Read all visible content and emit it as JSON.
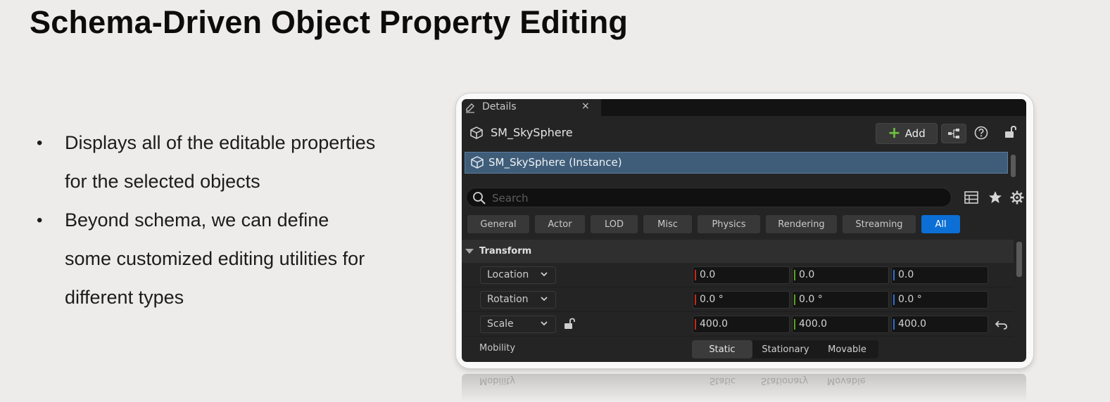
{
  "slide": {
    "title": "Schema-Driven Object Property Editing",
    "bullets": [
      {
        "line1": "Displays all of the editable properties",
        "line2": "for the selected objects"
      },
      {
        "line1": "Beyond schema, we can define",
        "line2": "some customized editing utilities for",
        "line3": "different types"
      }
    ]
  },
  "details": {
    "tab_label": "Details",
    "tab_close": "×",
    "actor_name": "SM_SkySphere",
    "add_label": "Add",
    "instance_label": "SM_SkySphere (Instance)",
    "search_placeholder": "Search",
    "categories": [
      "General",
      "Actor",
      "LOD",
      "Misc",
      "Physics",
      "Rendering",
      "Streaming",
      "All"
    ],
    "active_category": "All",
    "section": "Transform",
    "rows": {
      "location": {
        "label": "Location",
        "x": "0.0",
        "y": "0.0",
        "z": "0.0"
      },
      "rotation": {
        "label": "Rotation",
        "x": "0.0 °",
        "y": "0.0 °",
        "z": "0.0 °"
      },
      "scale": {
        "label": "Scale",
        "x": "400.0",
        "y": "400.0",
        "z": "400.0"
      }
    },
    "mobility": {
      "label": "Mobility",
      "options": [
        "Static",
        "Stationary",
        "Movable"
      ],
      "selected": "Static"
    }
  },
  "colors": {
    "accent": "#0b6fd6",
    "add_plus": "#6fc23c",
    "axis_x": "#c22a20",
    "axis_y": "#59a31c",
    "axis_z": "#2f6fd0",
    "selection": "#3f5d79"
  },
  "icons": [
    "edit-icon",
    "close-icon",
    "cube-icon",
    "plus-icon",
    "blueprint-icon",
    "help-icon",
    "lock-icon",
    "search-icon",
    "table-icon",
    "star-icon",
    "gear-icon",
    "chevron-down-icon",
    "reset-icon"
  ]
}
